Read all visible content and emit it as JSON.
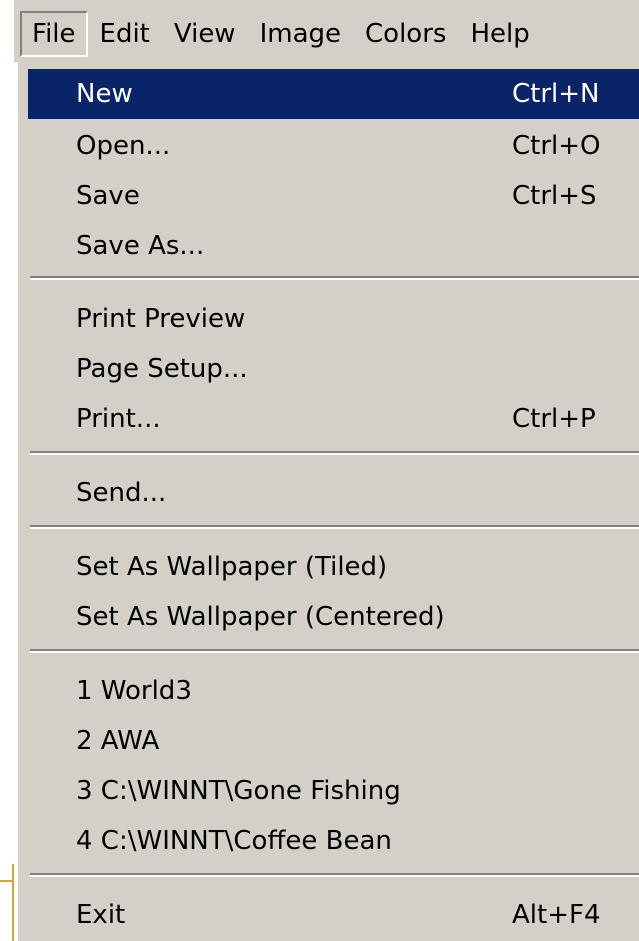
{
  "menubar": {
    "items": [
      "File",
      "Edit",
      "View",
      "Image",
      "Colors",
      "Help"
    ]
  },
  "file_menu": {
    "new": {
      "label": "New",
      "shortcut": "Ctrl+N"
    },
    "open": {
      "label": "Open...",
      "shortcut": "Ctrl+O"
    },
    "save": {
      "label": "Save",
      "shortcut": "Ctrl+S"
    },
    "save_as": {
      "label": "Save As..."
    },
    "print_preview": {
      "label": "Print Preview"
    },
    "page_setup": {
      "label": "Page Setup..."
    },
    "print": {
      "label": "Print...",
      "shortcut": "Ctrl+P"
    },
    "send": {
      "label": "Send..."
    },
    "wallpaper_tiled": {
      "label": "Set As Wallpaper (Tiled)"
    },
    "wallpaper_centered": {
      "label": "Set As Wallpaper (Centered)"
    },
    "recent": [
      "1 World3",
      "2 AWA",
      "3 C:\\WINNT\\Gone Fishing",
      "4 C:\\WINNT\\Coffee Bean"
    ],
    "exit": {
      "label": "Exit",
      "shortcut": "Alt+F4"
    }
  },
  "colors": {
    "menu_bg": "#d4d0c8",
    "highlight_bg": "#0a246a",
    "highlight_text": "#ffffff",
    "accent": "#d4a33a"
  }
}
